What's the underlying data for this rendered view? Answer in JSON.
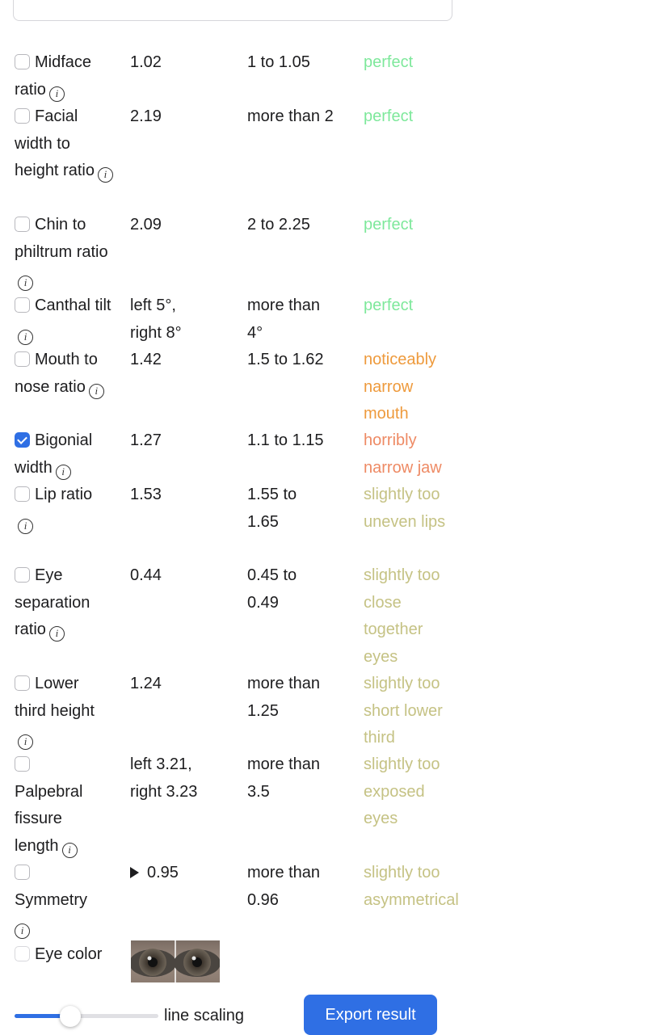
{
  "rows": [
    {
      "name": "Midface ratio",
      "value": "1.02",
      "range": "1 to 1.05",
      "rating": "perfect",
      "checked": false
    },
    {
      "name": "Facial width to height ratio",
      "value": "2.19",
      "range": "more than 2",
      "rating": "perfect",
      "checked": false
    },
    {
      "name": "Chin to philtrum ratio",
      "value": "2.09",
      "range": "2 to 2.25",
      "rating": "perfect",
      "checked": false
    },
    {
      "name": "Canthal tilt",
      "value": "left 5°, right 8°",
      "range": "more than 4°",
      "rating": "perfect",
      "checked": false
    },
    {
      "name": "Mouth to nose ratio",
      "value": "1.42",
      "range": "1.5 to 1.62",
      "rating": "noticeably narrow mouth",
      "checked": false
    },
    {
      "name": "Bigonial width",
      "value": "1.27",
      "range": "1.1 to 1.15",
      "rating": "horribly narrow jaw",
      "checked": true
    },
    {
      "name": "Lip ratio",
      "value": "1.53",
      "range": "1.55 to 1.65",
      "rating": "slightly too uneven lips",
      "checked": false
    },
    {
      "name": "Eye separation ratio",
      "value": "0.44",
      "range": "0.45 to 0.49",
      "rating": "slightly too close together eyes",
      "checked": false
    },
    {
      "name": "Lower third height",
      "value": "1.24",
      "range": "more than 1.25",
      "rating": "slightly too short lower third",
      "checked": false
    },
    {
      "name": "Palpebral fissure length",
      "value": "left 3.21, right 3.23",
      "range": "more than 3.5",
      "rating": "slightly too exposed eyes",
      "checked": false
    },
    {
      "name": "Symmetry",
      "value": "0.95",
      "range": "more than 0.96",
      "rating": "slightly too asymmetrical",
      "checked": false
    },
    {
      "name": "Eye color",
      "checked": false
    }
  ],
  "info_glyph": "i",
  "slider": {
    "label": "line scaling",
    "level": 0.39
  },
  "export_button": "Export result",
  "colors": {
    "perfect": "#7ee89b",
    "noticeably": "#ee9a3c",
    "horribly": "#ee8a64",
    "slightly": "#c5c284",
    "accent": "#2f6fe4"
  }
}
